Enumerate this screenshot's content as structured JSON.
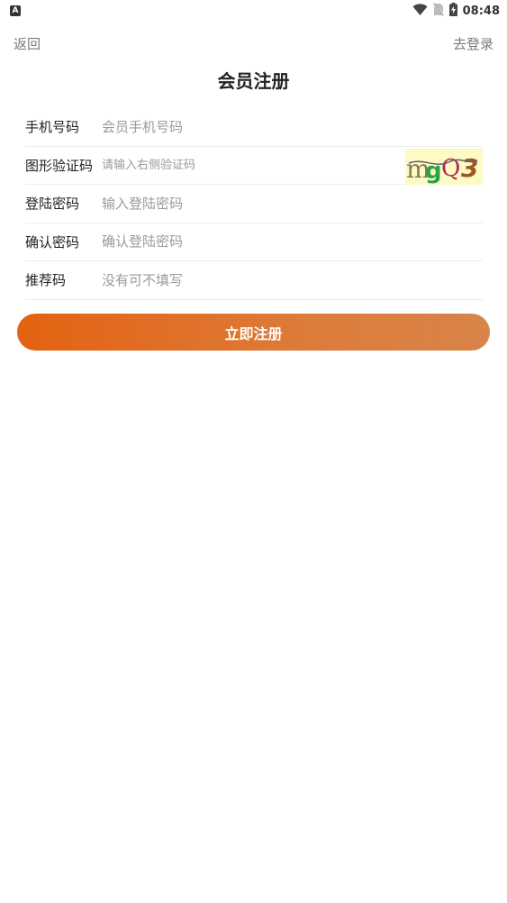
{
  "status_bar": {
    "time": "08:48",
    "left_icon": "A"
  },
  "nav": {
    "back_label": "返回",
    "login_label": "去登录"
  },
  "page": {
    "title": "会员注册"
  },
  "form": {
    "phone": {
      "label": "手机号码",
      "placeholder": "会员手机号码"
    },
    "captcha": {
      "label": "图形验证码",
      "placeholder": "请输入右侧验证码",
      "image_text": "mgQ3"
    },
    "password": {
      "label": "登陆密码",
      "placeholder": "输入登陆密码"
    },
    "confirm": {
      "label": "确认密码",
      "placeholder": "确认登陆密码"
    },
    "referral": {
      "label": "推荐码",
      "placeholder": "没有可不填写"
    }
  },
  "submit": {
    "label": "立即注册"
  },
  "colors": {
    "accent_start": "#e46211",
    "accent_end": "#d8844a",
    "captcha_bg": "#fdfac4"
  }
}
